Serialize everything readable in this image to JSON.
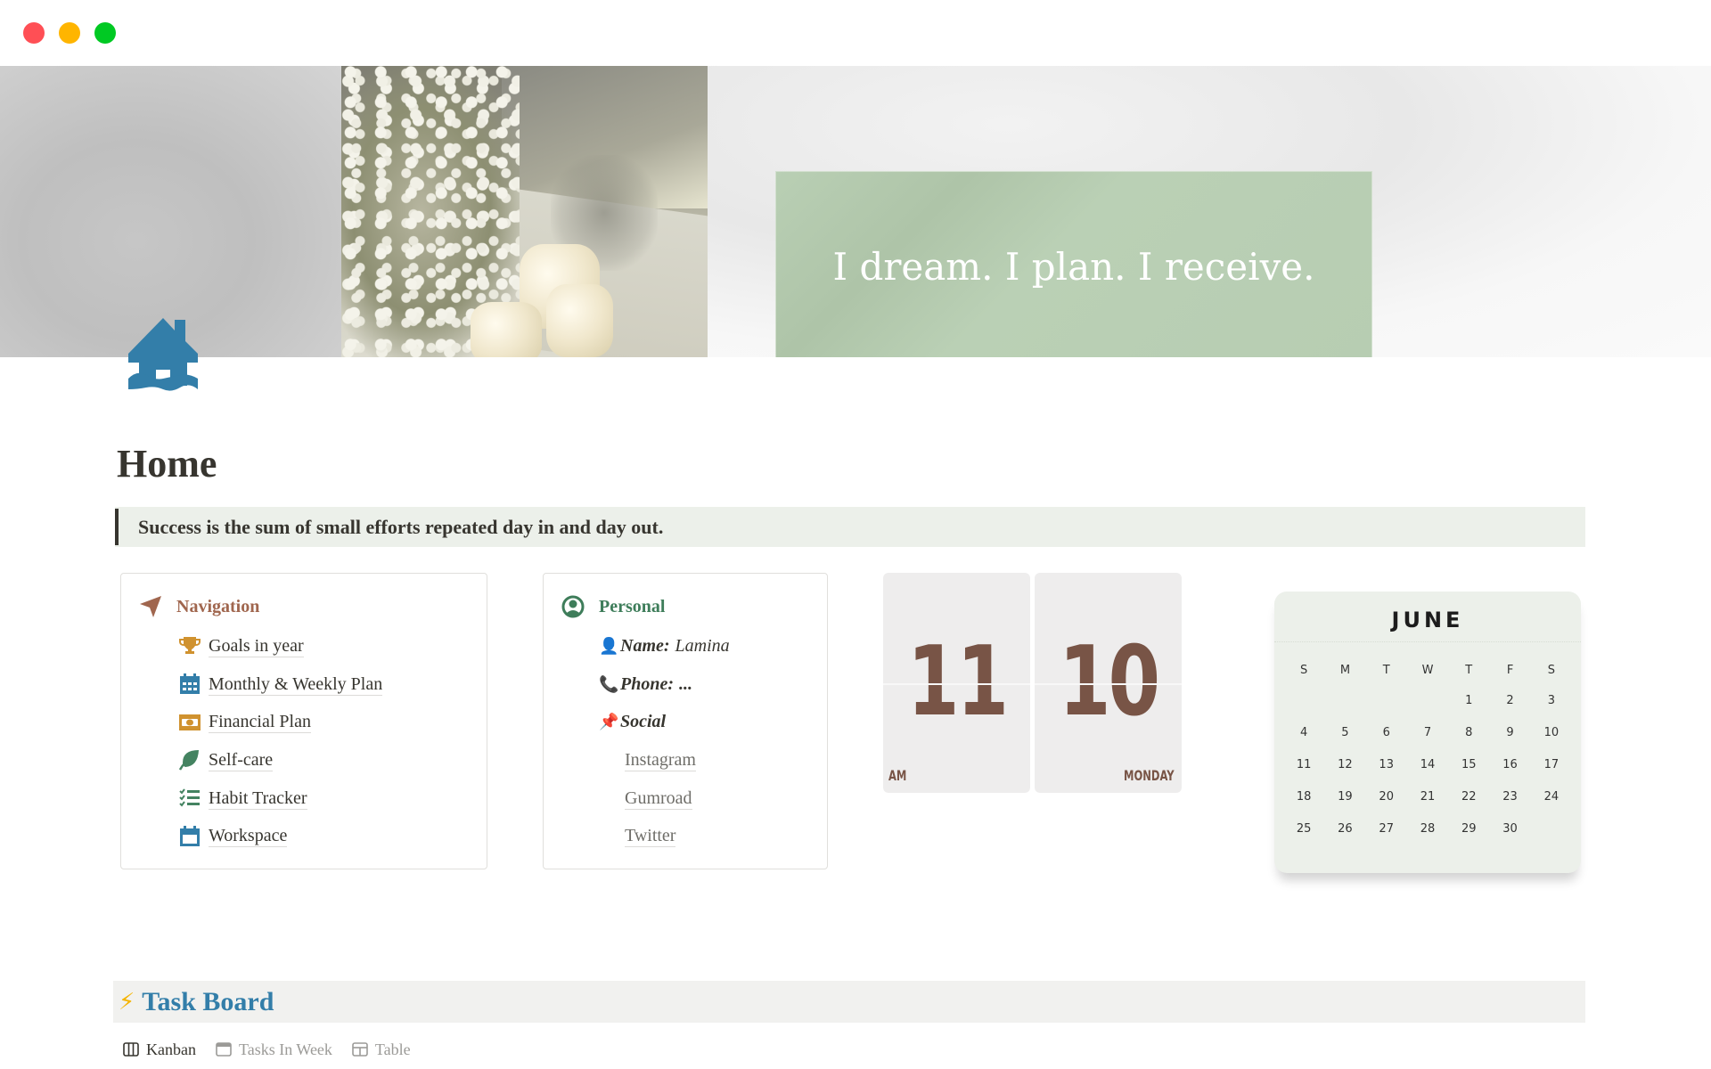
{
  "window": {
    "controls": [
      "close",
      "minimize",
      "maximize"
    ]
  },
  "cover": {
    "quote": "I dream. I plan. I receive."
  },
  "page": {
    "icon": "house-flood-icon",
    "title": "Home",
    "callout": "Success is the sum of small efforts repeated day in and day out."
  },
  "navigation": {
    "title": "Navigation",
    "icon": "location-arrow-icon",
    "color": "#a0664e",
    "items": [
      {
        "label": "Goals in year",
        "icon": "trophy-icon",
        "color": "#d0922f"
      },
      {
        "label": "Monthly & Weekly Plan",
        "icon": "calendar-grid-icon",
        "color": "#337ea9"
      },
      {
        "label": "Financial Plan",
        "icon": "money-bill-icon",
        "color": "#d0922f"
      },
      {
        "label": "Self-care",
        "icon": "leaf-icon",
        "color": "#448361"
      },
      {
        "label": "Habit Tracker",
        "icon": "checklist-icon",
        "color": "#448361"
      },
      {
        "label": "Workspace",
        "icon": "calendar-icon",
        "color": "#337ea9"
      }
    ]
  },
  "personal": {
    "title": "Personal",
    "icon": "user-circle-icon",
    "color": "#3e7d5a",
    "name_label": "Name:",
    "name_value": "Lamina",
    "phone_label": "Phone:",
    "phone_value": "...",
    "social_label": "Social",
    "name_emoji": "👤",
    "phone_emoji": "📞",
    "social_emoji": "📌",
    "links": [
      "Instagram",
      "Gumroad",
      "Twitter"
    ]
  },
  "clock": {
    "hour": "11",
    "minute": "10",
    "period": "AM",
    "weekday": "MONDAY",
    "digit_color": "#785446"
  },
  "calendar": {
    "month": "JUNE",
    "weekdays": [
      "S",
      "M",
      "T",
      "W",
      "T",
      "F",
      "S"
    ],
    "leading_blanks": 4,
    "days": [
      1,
      2,
      3,
      4,
      5,
      6,
      7,
      8,
      9,
      10,
      11,
      12,
      13,
      14,
      15,
      16,
      17,
      18,
      19,
      20,
      21,
      22,
      23,
      24,
      25,
      26,
      27,
      28,
      29,
      30
    ]
  },
  "taskboard": {
    "emoji": "⚡",
    "title": "Task Board",
    "views": [
      {
        "label": "Kanban",
        "icon": "board-icon",
        "active": true
      },
      {
        "label": "Tasks In Week",
        "icon": "calendar-view-icon",
        "active": false
      },
      {
        "label": "Table",
        "icon": "table-icon",
        "active": false
      }
    ]
  }
}
